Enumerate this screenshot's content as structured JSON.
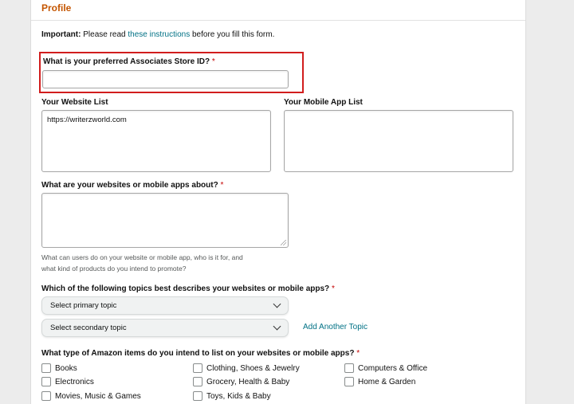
{
  "header": {
    "title": "Profile"
  },
  "important": {
    "label": "Important:",
    "pre": "Please read",
    "link": "these instructions",
    "post": "before you fill this form."
  },
  "store_id": {
    "label": "What is your preferred Associates Store ID?",
    "required": "*",
    "value": ""
  },
  "website_list": {
    "label": "Your Website List",
    "value": "https://writerzworld.com"
  },
  "app_list": {
    "label": "Your Mobile App List",
    "value": ""
  },
  "about": {
    "label": "What are your websites or mobile apps about?",
    "required": "*",
    "value": "",
    "hint_line1": "What can users do on your website or mobile app, who is it for, and",
    "hint_line2": "what kind of products do you intend to promote?"
  },
  "topics": {
    "label": "Which of the following topics best describes your websites or mobile apps?",
    "required": "*",
    "primary": "Select primary topic",
    "secondary": "Select secondary topic",
    "add_link": "Add Another Topic"
  },
  "items": {
    "label": "What type of Amazon items do you intend to list on your websites or mobile apps?",
    "required": "*",
    "options": [
      "Books",
      "Electronics",
      "Movies, Music & Games",
      "Clothing, Shoes & Jewelry",
      "Grocery, Health & Baby",
      "Toys, Kids & Baby",
      "Computers & Office",
      "Home & Garden"
    ]
  },
  "colors": {
    "header_title": "#c45500",
    "link": "#007185",
    "highlight": "#d11d1d",
    "required": "#c40000"
  }
}
